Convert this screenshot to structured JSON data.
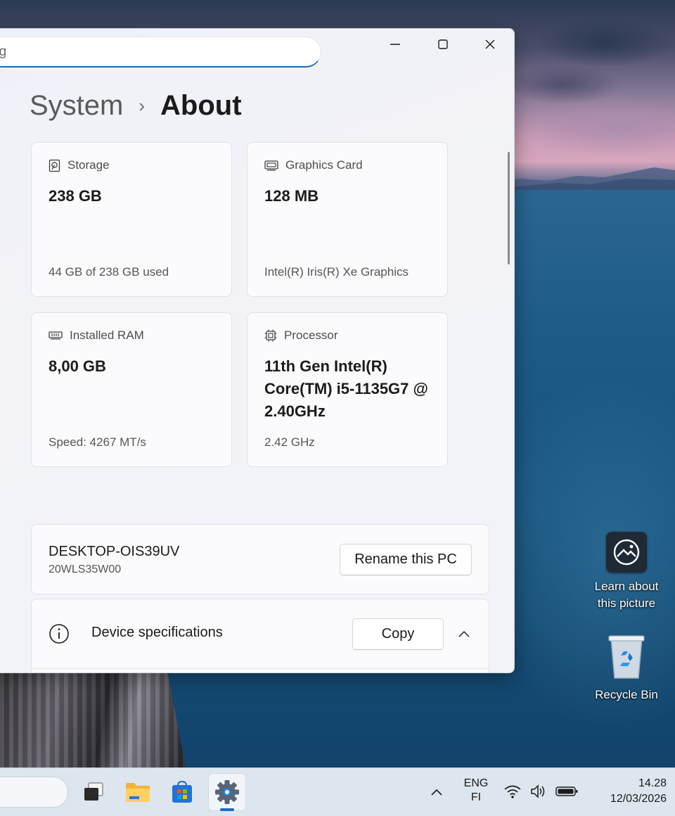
{
  "window": {
    "search_value": "ng",
    "breadcrumb": {
      "parent": "System",
      "separator": "›",
      "current": "About"
    }
  },
  "cards": {
    "storage": {
      "label": "Storage",
      "value": "238 GB",
      "sub": "44 GB of 238 GB used"
    },
    "graphics": {
      "label": "Graphics Card",
      "value": "128 MB",
      "sub": "Intel(R) Iris(R) Xe Graphics"
    },
    "ram": {
      "label": "Installed RAM",
      "value": "8,00 GB",
      "sub": "Speed: 4267 MT/s"
    },
    "processor": {
      "label": "Processor",
      "value": "11th Gen Intel(R) Core(TM) i5-1135G7 @ 2.40GHz",
      "sub": "2.42 GHz"
    }
  },
  "device": {
    "name": "DESKTOP-OIS39UV",
    "model": "20WLS35W00",
    "rename_label": "Rename this PC"
  },
  "specs": {
    "label": "Device specifications",
    "copy_label": "Copy"
  },
  "desktop": {
    "learn_label_line1": "Learn about",
    "learn_label_line2": "this picture",
    "recycle_label": "Recycle Bin"
  },
  "taskbar": {
    "lang_top": "ENG",
    "lang_bottom": "FI",
    "time": "14.28",
    "date": "12/03/2026"
  },
  "colors": {
    "accent": "#1f66b6",
    "window_bg": "#f3f3f7",
    "taskbar_bg": "#dde5ee"
  }
}
